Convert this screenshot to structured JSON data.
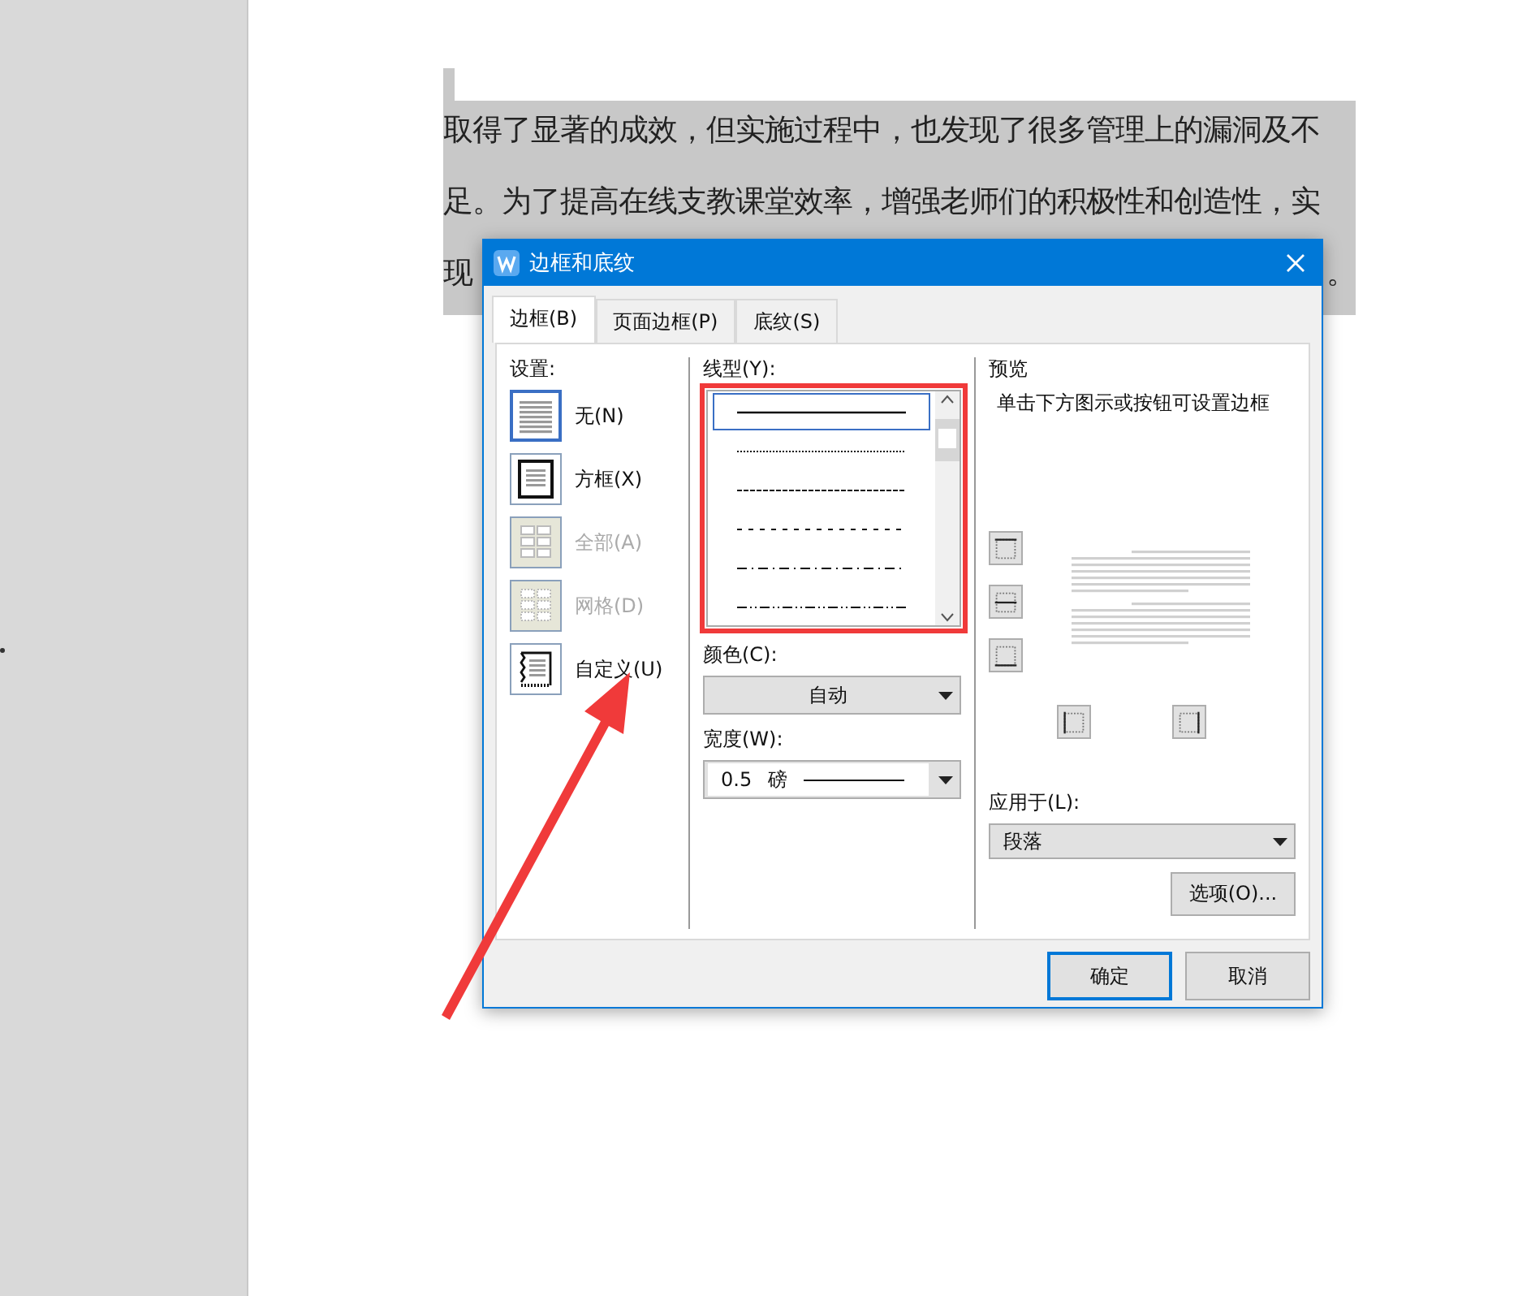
{
  "document": {
    "lines": [
      "取得了显著的成效，但实施过程中，也发现了很多管理上的漏洞及不",
      "足。为了提高在线支教课堂效率，增强老师们的积极性和创造性，实"
    ],
    "line3_start": "现",
    "line3_end": "。"
  },
  "dialog": {
    "title": "边框和底纹",
    "tabs": [
      {
        "label": "边框(B)",
        "selected": true
      },
      {
        "label": "页面边框(P)",
        "selected": false
      },
      {
        "label": "底纹(S)",
        "selected": false
      }
    ],
    "settings_label": "设置:",
    "settings": [
      {
        "kind": "none",
        "label": "无(N)",
        "selected": true,
        "disabled": false
      },
      {
        "kind": "box",
        "label": "方框(X)",
        "selected": false,
        "disabled": false
      },
      {
        "kind": "all",
        "label": "全部(A)",
        "selected": false,
        "disabled": true
      },
      {
        "kind": "grid",
        "label": "网格(D)",
        "selected": false,
        "disabled": true
      },
      {
        "kind": "custom",
        "label": "自定义(U)",
        "selected": false,
        "disabled": false
      }
    ],
    "line_style_label": "线型(Y):",
    "line_styles": [
      {
        "kind": "solid",
        "selected": true
      },
      {
        "kind": "dotted",
        "selected": false
      },
      {
        "kind": "dashed",
        "selected": false
      },
      {
        "kind": "sparse",
        "selected": false
      },
      {
        "kind": "dashdot",
        "selected": false
      },
      {
        "kind": "dashdotdot",
        "selected": false
      }
    ],
    "color_label": "颜色(C):",
    "color_value": "自动",
    "width_label": "宽度(W):",
    "width_value": "0.5",
    "width_unit": "磅",
    "preview_label": "预览",
    "preview_hint": "单击下方图示或按钮可设置边框",
    "apply_label": "应用于(L):",
    "apply_value": "段落",
    "options_button": "选项(O)...",
    "buttons": [
      {
        "label": "确定",
        "default": true
      },
      {
        "label": "取消",
        "default": false
      }
    ]
  }
}
